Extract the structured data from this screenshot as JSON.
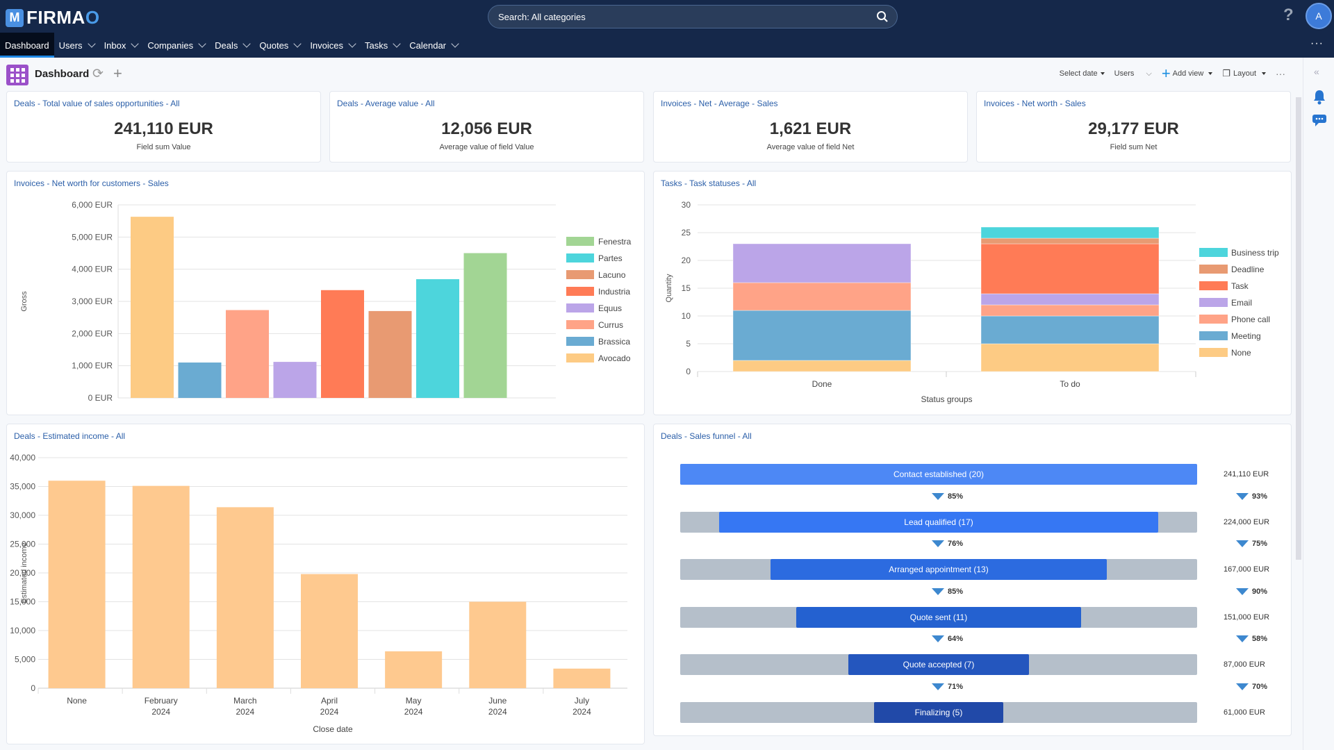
{
  "app": {
    "logo_text_main": "FIRMA",
    "logo_text_accent": "O"
  },
  "search": {
    "placeholder": "Search: All categories"
  },
  "header": {
    "help": "?",
    "avatar_initial": "A",
    "more": "···"
  },
  "nav": [
    {
      "label": "Dashboard",
      "active": true,
      "dropdown": false
    },
    {
      "label": "Users",
      "dropdown": true
    },
    {
      "label": "Inbox",
      "dropdown": true
    },
    {
      "label": "Companies",
      "dropdown": true
    },
    {
      "label": "Deals",
      "dropdown": true
    },
    {
      "label": "Quotes",
      "dropdown": true
    },
    {
      "label": "Invoices",
      "dropdown": true
    },
    {
      "label": "Tasks",
      "dropdown": true
    },
    {
      "label": "Calendar",
      "dropdown": true
    }
  ],
  "toolbar": {
    "title": "Dashboard",
    "select_date": "Select date",
    "users": "Users",
    "add_view": "Add view",
    "layout": "Layout",
    "more": "···"
  },
  "kpis": [
    {
      "title": "Deals - Total value of sales opportunities - All",
      "value": "241,110 EUR",
      "sub": "Field sum Value"
    },
    {
      "title": "Deals - Average value - All",
      "value": "12,056 EUR",
      "sub": "Average value of field Value"
    },
    {
      "title": "Invoices - Net - Average - Sales",
      "value": "1,621 EUR",
      "sub": "Average value of field Net"
    },
    {
      "title": "Invoices - Net worth - Sales",
      "value": "29,177 EUR",
      "sub": "Field sum Net"
    }
  ],
  "chart_data": [
    {
      "type": "bar",
      "title": "Invoices - Net worth for customers - Sales",
      "ylabel": "Gross",
      "xlabel": "",
      "ylim": [
        0,
        6000
      ],
      "yticks": [
        "0 EUR",
        "1,000 EUR",
        "2,000 EUR",
        "3,000 EUR",
        "4,000 EUR",
        "5,000 EUR",
        "6,000 EUR"
      ],
      "categories": [
        "Avocado",
        "Brassica",
        "Currus",
        "Equus",
        "Industria",
        "Lacuno",
        "Partes",
        "Fenestra"
      ],
      "values": [
        5630,
        1100,
        2730,
        1120,
        3350,
        2700,
        3690,
        4500
      ],
      "colors": [
        "#fdcb84",
        "#6aabd2",
        "#ffa387",
        "#bba5e8",
        "#ff7b56",
        "#e89a72",
        "#4dd5dc",
        "#a2d594"
      ],
      "legend": [
        "Fenestra",
        "Partes",
        "Lacuno",
        "Industria",
        "Equus",
        "Currus",
        "Brassica",
        "Avocado"
      ],
      "legend_position": "right",
      "grid": true
    },
    {
      "type": "bar",
      "stacked": true,
      "title": "Tasks - Task statuses - All",
      "ylabel": "Quantity",
      "xlabel": "Status groups",
      "ylim": [
        0,
        30
      ],
      "yticks": [
        "0",
        "5",
        "10",
        "15",
        "20",
        "25",
        "30"
      ],
      "categories": [
        "Done",
        "To do"
      ],
      "series": [
        {
          "name": "None",
          "color": "#fdcb84",
          "values": [
            2,
            5
          ]
        },
        {
          "name": "Meeting",
          "color": "#6aabd2",
          "values": [
            9,
            5
          ]
        },
        {
          "name": "Phone call",
          "color": "#ffa387",
          "values": [
            5,
            2
          ]
        },
        {
          "name": "Email",
          "color": "#bba5e8",
          "values": [
            7,
            2
          ]
        },
        {
          "name": "Task",
          "color": "#ff7b56",
          "values": [
            0,
            9
          ]
        },
        {
          "name": "Deadline",
          "color": "#e89a72",
          "values": [
            0,
            1
          ]
        },
        {
          "name": "Business trip",
          "color": "#4dd5dc",
          "values": [
            0,
            2
          ]
        }
      ],
      "legend_position": "right",
      "grid": true
    },
    {
      "type": "bar",
      "title": "Deals - Estimated income - All",
      "ylabel": "Estimated income",
      "xlabel": "Close date",
      "ylim": [
        0,
        40000
      ],
      "yticks": [
        "0",
        "5,000",
        "10,000",
        "15,000",
        "20,000",
        "25,000",
        "30,000",
        "35,000",
        "40,000"
      ],
      "categories": [
        [
          "None",
          ""
        ],
        [
          "February",
          "2024"
        ],
        [
          "March",
          "2024"
        ],
        [
          "April",
          "2024"
        ],
        [
          "May",
          "2024"
        ],
        [
          "June",
          "2024"
        ],
        [
          "July",
          "2024"
        ]
      ],
      "values": [
        36000,
        35100,
        31400,
        19800,
        6400,
        15000,
        3400
      ],
      "color": "#fec98f",
      "grid": true
    },
    {
      "type": "funnel",
      "title": "Deals - Sales funnel - All",
      "stages": [
        {
          "label": "Contact established (20)",
          "count": 20,
          "value": "241,110 EUR",
          "color": "#4d88f5"
        },
        {
          "label": "Lead qualified (17)",
          "count": 17,
          "value": "224,000 EUR",
          "color": "#3677f3",
          "conv_count": "85%",
          "conv_value": "93%"
        },
        {
          "label": "Arranged appointment (13)",
          "count": 13,
          "value": "167,000 EUR",
          "color": "#2c6be0",
          "conv_count": "76%",
          "conv_value": "75%"
        },
        {
          "label": "Quote sent (11)",
          "count": 11,
          "value": "151,000 EUR",
          "color": "#2461d0",
          "conv_count": "85%",
          "conv_value": "90%"
        },
        {
          "label": "Quote accepted (7)",
          "count": 7,
          "value": "87,000 EUR",
          "color": "#2456be",
          "conv_count": "64%",
          "conv_value": "58%"
        },
        {
          "label": "Finalizing (5)",
          "count": 5,
          "value": "61,000 EUR",
          "color": "#2149a8",
          "conv_count": "71%",
          "conv_value": "70%"
        }
      ]
    }
  ]
}
